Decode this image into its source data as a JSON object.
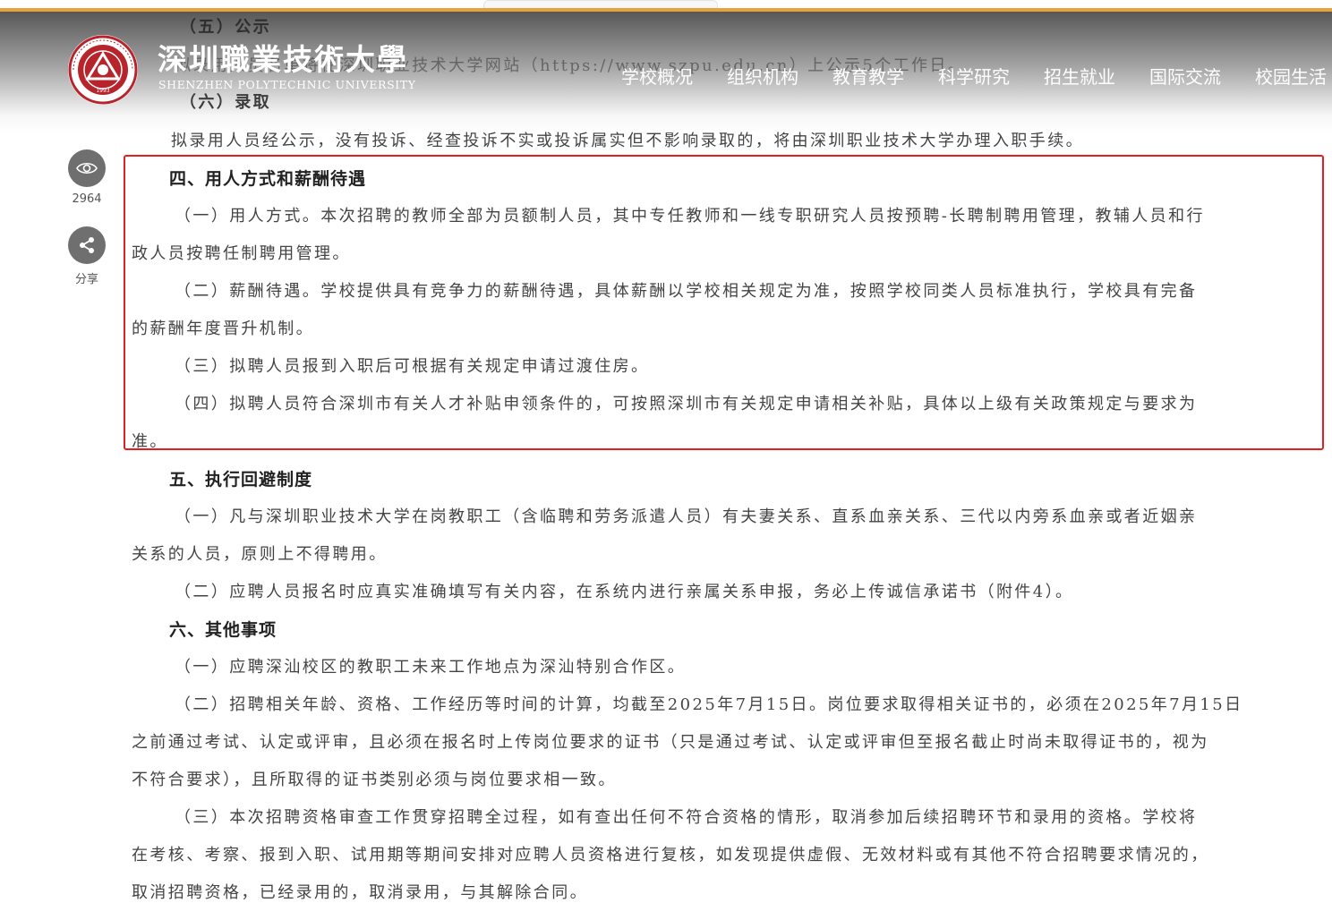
{
  "header": {
    "brand_cn": "深圳職業技術大學",
    "brand_en": "SHENZHEN POLYTECHNIC UNIVERSITY",
    "logo_year": "1993",
    "nav": [
      "学校概况",
      "组织机构",
      "教育教学",
      "科学研究",
      "招生就业",
      "国际交流",
      "校园生活"
    ]
  },
  "side": {
    "views_count": "2964",
    "share_label": "分享"
  },
  "article": {
    "sec5_title": "（五）公示",
    "sec5_text": "拟录用人员名单将在深圳职业技术大学网站（https://www.szpu.edu.cn）上公示5个工作日。",
    "sec6_title": "（六）录取",
    "sec6_text": "拟录用人员经公示，没有投诉、经查投诉不实或投诉属实但不影响录取的，将由深圳职业技术大学办理入职手续。",
    "part4_title": "四、用人方式和薪酬待遇",
    "p4_1a": "（一）用人方式。本次招聘的教师全部为员额制人员，其中专任教师和一线专职研究人员按预聘-长聘制聘用管理，教辅人员和行",
    "p4_1b": "政人员按聘任制聘用管理。",
    "p4_2a": "（二）薪酬待遇。学校提供具有竞争力的薪酬待遇，具体薪酬以学校相关规定为准，按照学校同类人员标准执行，学校具有完备",
    "p4_2b": "的薪酬年度晋升机制。",
    "p4_3": "（三）拟聘人员报到入职后可根据有关规定申请过渡住房。",
    "p4_4a": "（四）拟聘人员符合深圳市有关人才补贴申领条件的，可按照深圳市有关规定申请相关补贴，具体以上级有关政策规定与要求为",
    "p4_4b": "准。",
    "part5_title": "五、执行回避制度",
    "p5_1a": "（一）凡与深圳职业技术大学在岗教职工（含临聘和劳务派遣人员）有夫妻关系、直系血亲关系、三代以内旁系血亲或者近姻亲",
    "p5_1b": "关系的人员，原则上不得聘用。",
    "p5_2": "（二）应聘人员报名时应真实准确填写有关内容，在系统内进行亲属关系申报，务必上传诚信承诺书（附件4）。",
    "part6_title": "六、其他事项",
    "p6_1": "（一）应聘深汕校区的教职工未来工作地点为深汕特别合作区。",
    "p6_2a": "（二）招聘相关年龄、资格、工作经历等时间的计算，均截至2025年7月15日。岗位要求取得相关证书的，必须在2025年7月15日",
    "p6_2b": "之前通过考试、认定或评审，且必须在报名时上传岗位要求的证书（只是通过考试、认定或评审但至报名截止时尚未取得证书的，视为",
    "p6_2c": "不符合要求），且所取得的证书类别必须与岗位要求相一致。",
    "p6_3a": "（三）本次招聘资格审查工作贯穿招聘全过程，如有查出任何不符合资格的情形，取消参加后续招聘环节和录用的资格。学校将",
    "p6_3b": "在考核、考察、报到入职、试用期等期间安排对应聘人员资格进行复核，如发现提供虚假、无效材料或有其他不符合招聘要求情况的，",
    "p6_3c": "取消招聘资格，已经录用的，取消录用，与其解除合同。"
  },
  "colors": {
    "accent_orange": "#e8a23c",
    "highlight_red": "#e02020",
    "logo_red": "#b8242c"
  }
}
